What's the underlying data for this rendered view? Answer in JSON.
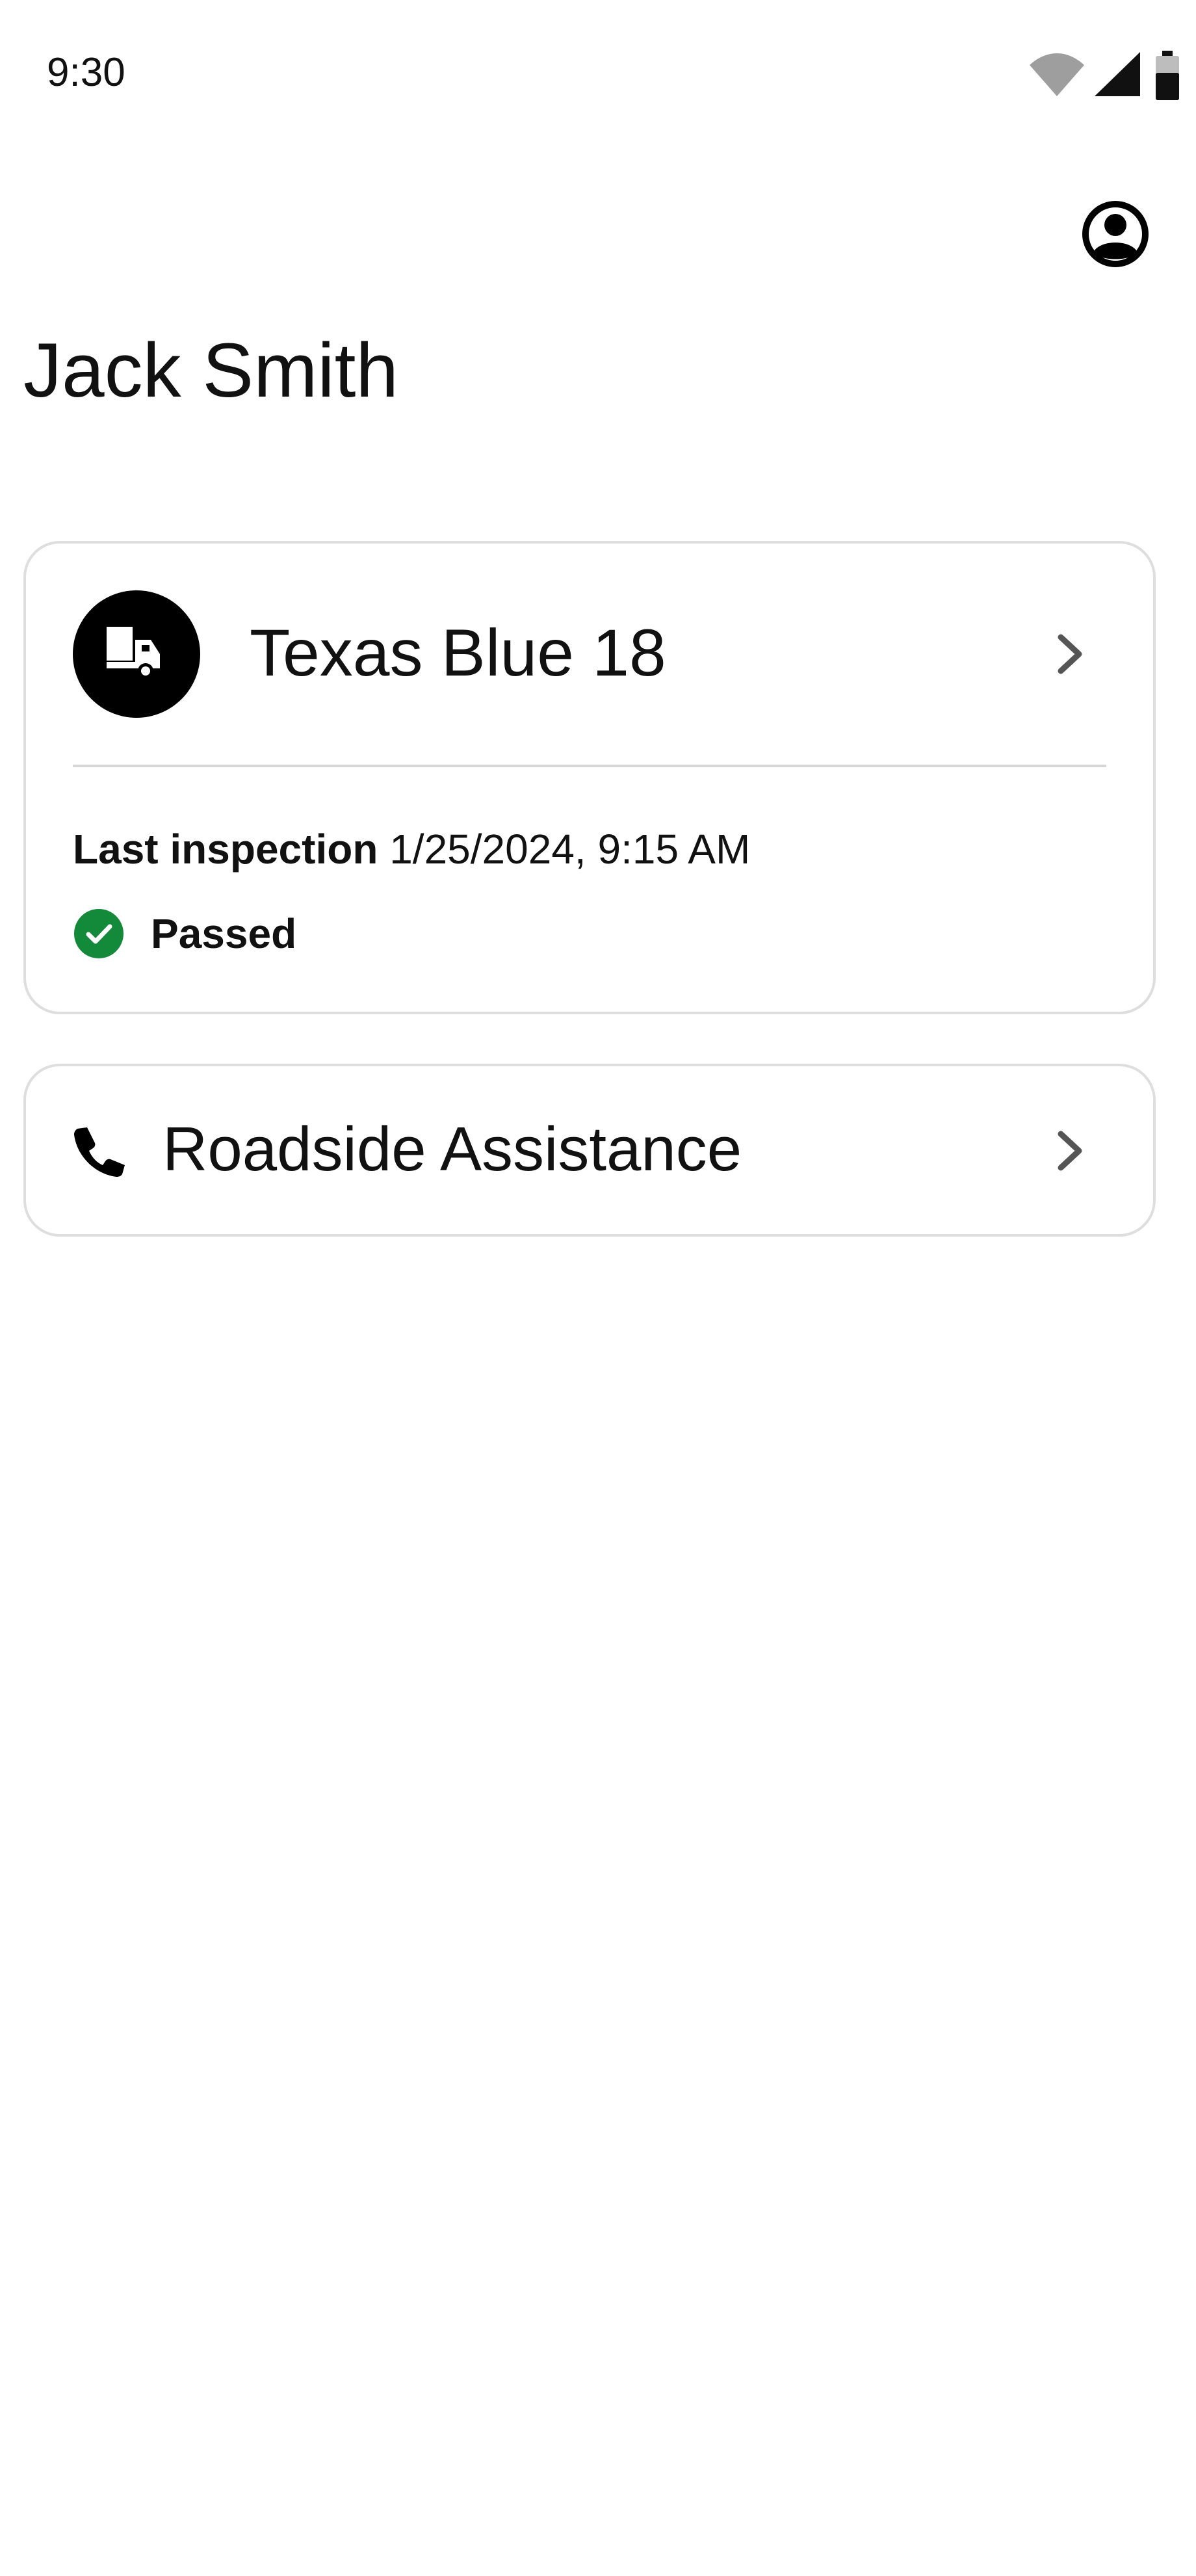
{
  "status_bar": {
    "time": "9:30",
    "icons": [
      "wifi-icon",
      "cellular-signal-icon",
      "battery-icon"
    ]
  },
  "header": {
    "profile_icon": "account-circle-icon",
    "title": "Jack Smith"
  },
  "vehicle_card": {
    "icon": "truck-icon",
    "name": "Texas Blue 18",
    "inspection_label": "Last inspection",
    "inspection_datetime": "1/25/2024, 9:15 AM",
    "status_icon": "check-circle-icon",
    "status_text": "Passed"
  },
  "roadside_card": {
    "icon": "phone-icon",
    "label": "Roadside Assistance"
  },
  "colors": {
    "pass_green": "#128a3a",
    "border": "#dedede",
    "text": "#111111",
    "chevron": "#555555"
  }
}
